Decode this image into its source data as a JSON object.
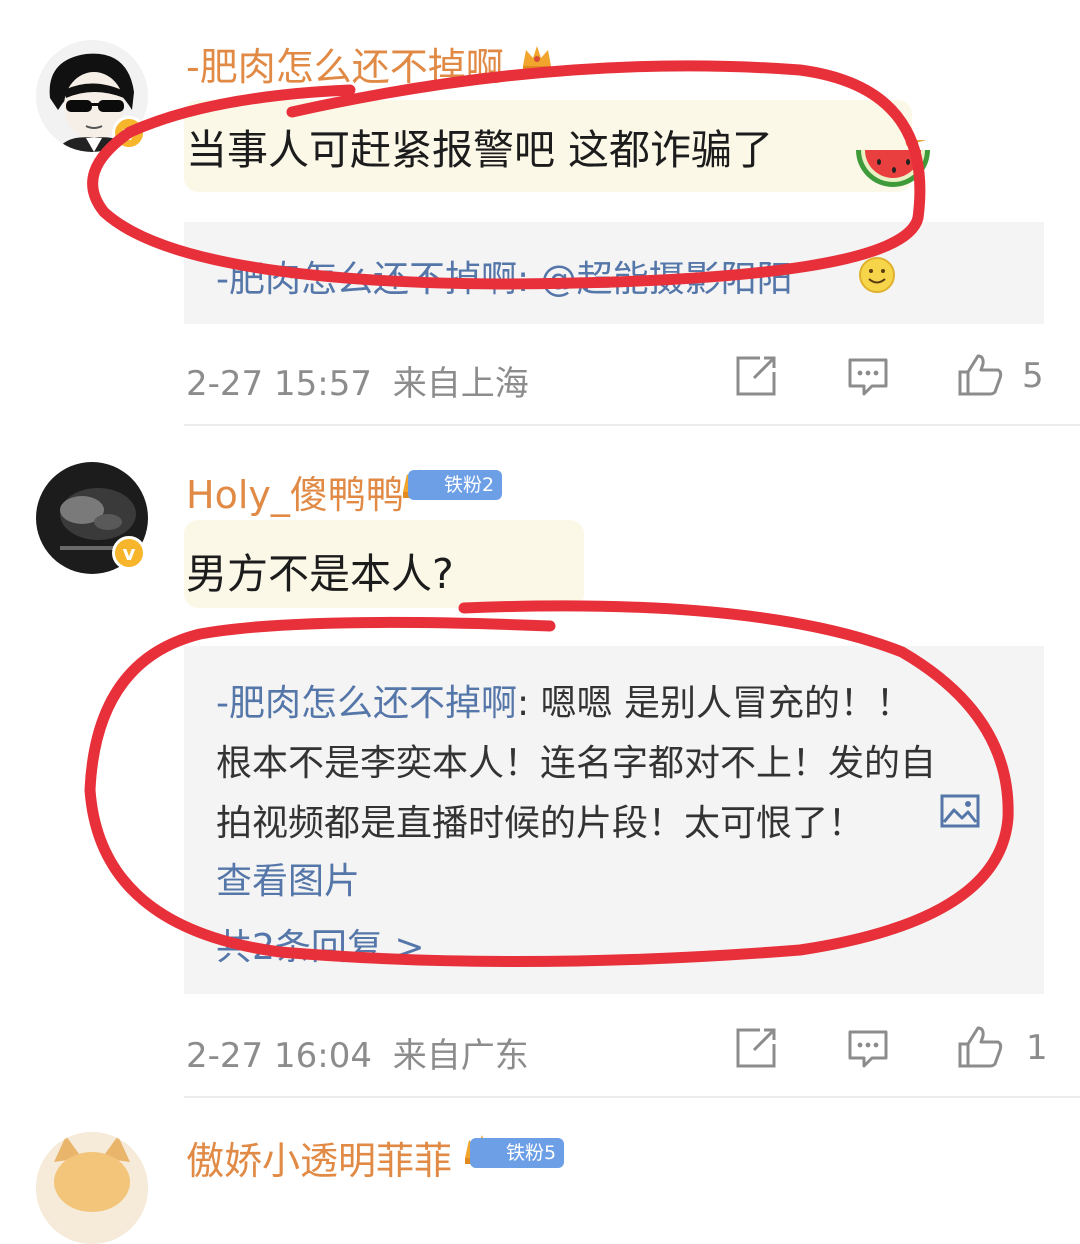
{
  "comments": [
    {
      "username": "-肥肉怎么还不掉啊",
      "content": "当事人可赶紧报警吧 这都诈骗了",
      "reply_author": "-肥肉怎么还不掉啊",
      "reply_text": ": @超能摄影阳阳",
      "time": "2-27 15:57",
      "location": "来自上海",
      "likes": "5",
      "emoji_icon": "watermelon-icon"
    },
    {
      "username": "Holy_傻鸭鸭",
      "fan_badge": "铁粉2",
      "content": "男方不是本人?",
      "reply_author": "-肥肉怎么还不掉啊",
      "reply_line1_text": ": 嗯嗯 是别人冒充的！！",
      "reply_line2": "根本不是李奕本人！连名字都对不上！发的自",
      "reply_line3": "拍视频都是直播时候的片段！太可恨了！",
      "view_image": "查看图片",
      "more_replies": "共2条回复 >",
      "time": "2-27 16:04",
      "location": "来自广东",
      "likes": "1"
    },
    {
      "username": "傲娇小透明菲菲",
      "fan_badge": "铁粉5"
    }
  ],
  "colors": {
    "username": "#e08a45",
    "link": "#5576a8",
    "annotation": "#e8303a",
    "badge": "#6d9fe6"
  }
}
